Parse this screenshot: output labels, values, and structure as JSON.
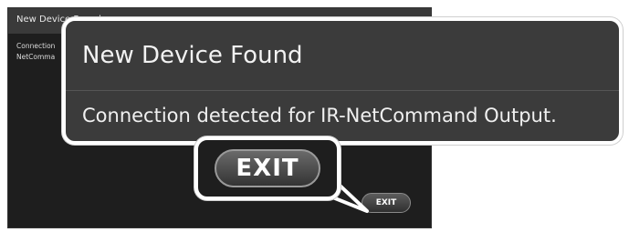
{
  "background_dialog": {
    "title": "New Device Found",
    "body_line1": "Connection",
    "body_line2": "NetComma",
    "exit_label": "EXIT"
  },
  "callout": {
    "title": "New Device Found",
    "message": "Connection detected for IR-NetCommand Output."
  },
  "exit_callout": {
    "exit_label": "EXIT"
  },
  "colors": {
    "dialog_bg": "#3b3b3b",
    "screen_bg": "#1e1e1e",
    "callout_border": "#ffffff"
  }
}
